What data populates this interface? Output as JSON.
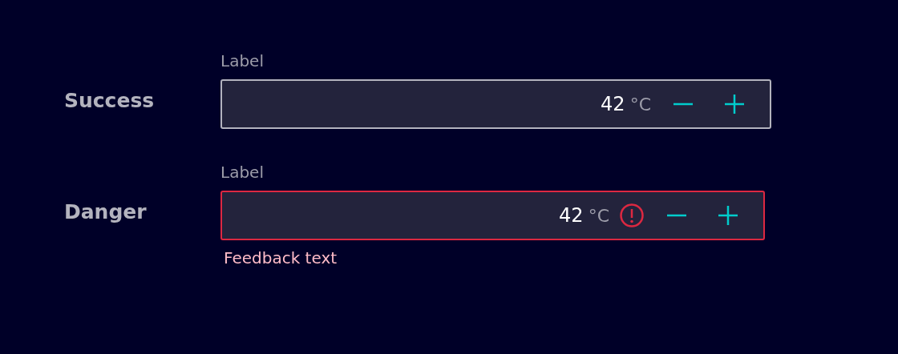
{
  "rows": [
    {
      "kind": "success",
      "title": "Success",
      "label": "Label",
      "value": "42",
      "unit": "°C"
    },
    {
      "kind": "danger",
      "title": "Danger",
      "label": "Label",
      "value": "42",
      "unit": "°C",
      "feedback": "Feedback text"
    }
  ]
}
